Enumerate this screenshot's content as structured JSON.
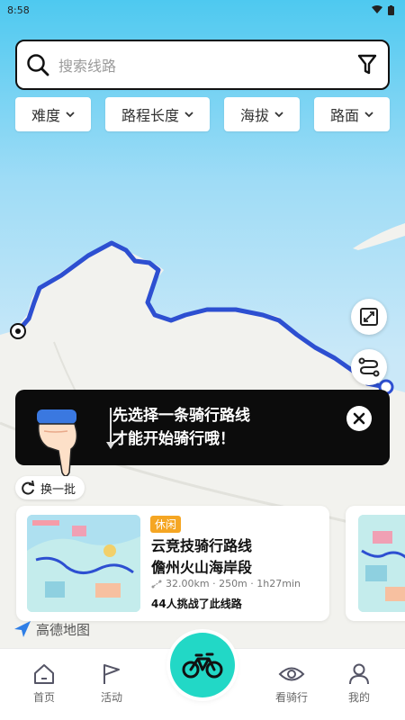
{
  "status": {
    "time": "8:58"
  },
  "search": {
    "placeholder": "搜索线路"
  },
  "filters": [
    {
      "label": "难度"
    },
    {
      "label": "路程长度"
    },
    {
      "label": "海拔"
    },
    {
      "label": "路面"
    }
  ],
  "tip": {
    "line1": "先选择一条骑行路线",
    "line2": "才能开始骑行哦！"
  },
  "refresh_label": "换一批",
  "route_card": {
    "badge": "休闲",
    "title_line1": "云竞技骑行路线",
    "title_line2": "儋州火山海岸段",
    "stats": "32.00km · 250m · 1h27min",
    "challenged": "44人挑战了此线路"
  },
  "map_attribution": "高德地图",
  "nav": [
    {
      "label": "首页",
      "icon": "home-icon"
    },
    {
      "label": "活动",
      "icon": "flag-icon"
    },
    {
      "label": "看骑行",
      "icon": "eye-icon"
    },
    {
      "label": "我的",
      "icon": "person-icon"
    }
  ],
  "colors": {
    "route": "#2d4fd1",
    "sea_top": "#4ec9f0",
    "accent": "#22d8c6",
    "badge": "#f5a623"
  }
}
